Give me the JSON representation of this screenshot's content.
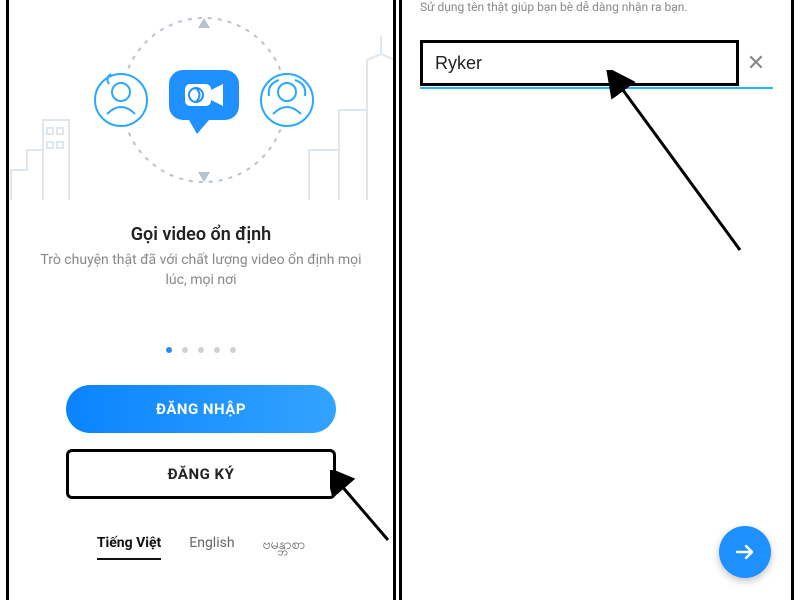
{
  "left": {
    "heading": "Gọi video ổn định",
    "subheading": "Trò chuyện thật đã với chất lượng video ổn định mọi lúc, mọi nơi",
    "page_dots": {
      "count": 5,
      "active": 0
    },
    "login_label": "ĐĂNG NHẬP",
    "register_label": "ĐĂNG KÝ",
    "languages": [
      "Tiếng Việt",
      "English",
      "ဗမန္ဘာစာ"
    ],
    "active_language": 0
  },
  "right": {
    "hint": "Sử dụng tên thật giúp bạn bè dễ dàng nhận ra bạn.",
    "name_value": "Ryker",
    "clear_glyph": "✕",
    "fab_icon": "arrow-right-icon"
  },
  "colors": {
    "primary": "#1e90ff",
    "underline": "#22b6ff"
  }
}
